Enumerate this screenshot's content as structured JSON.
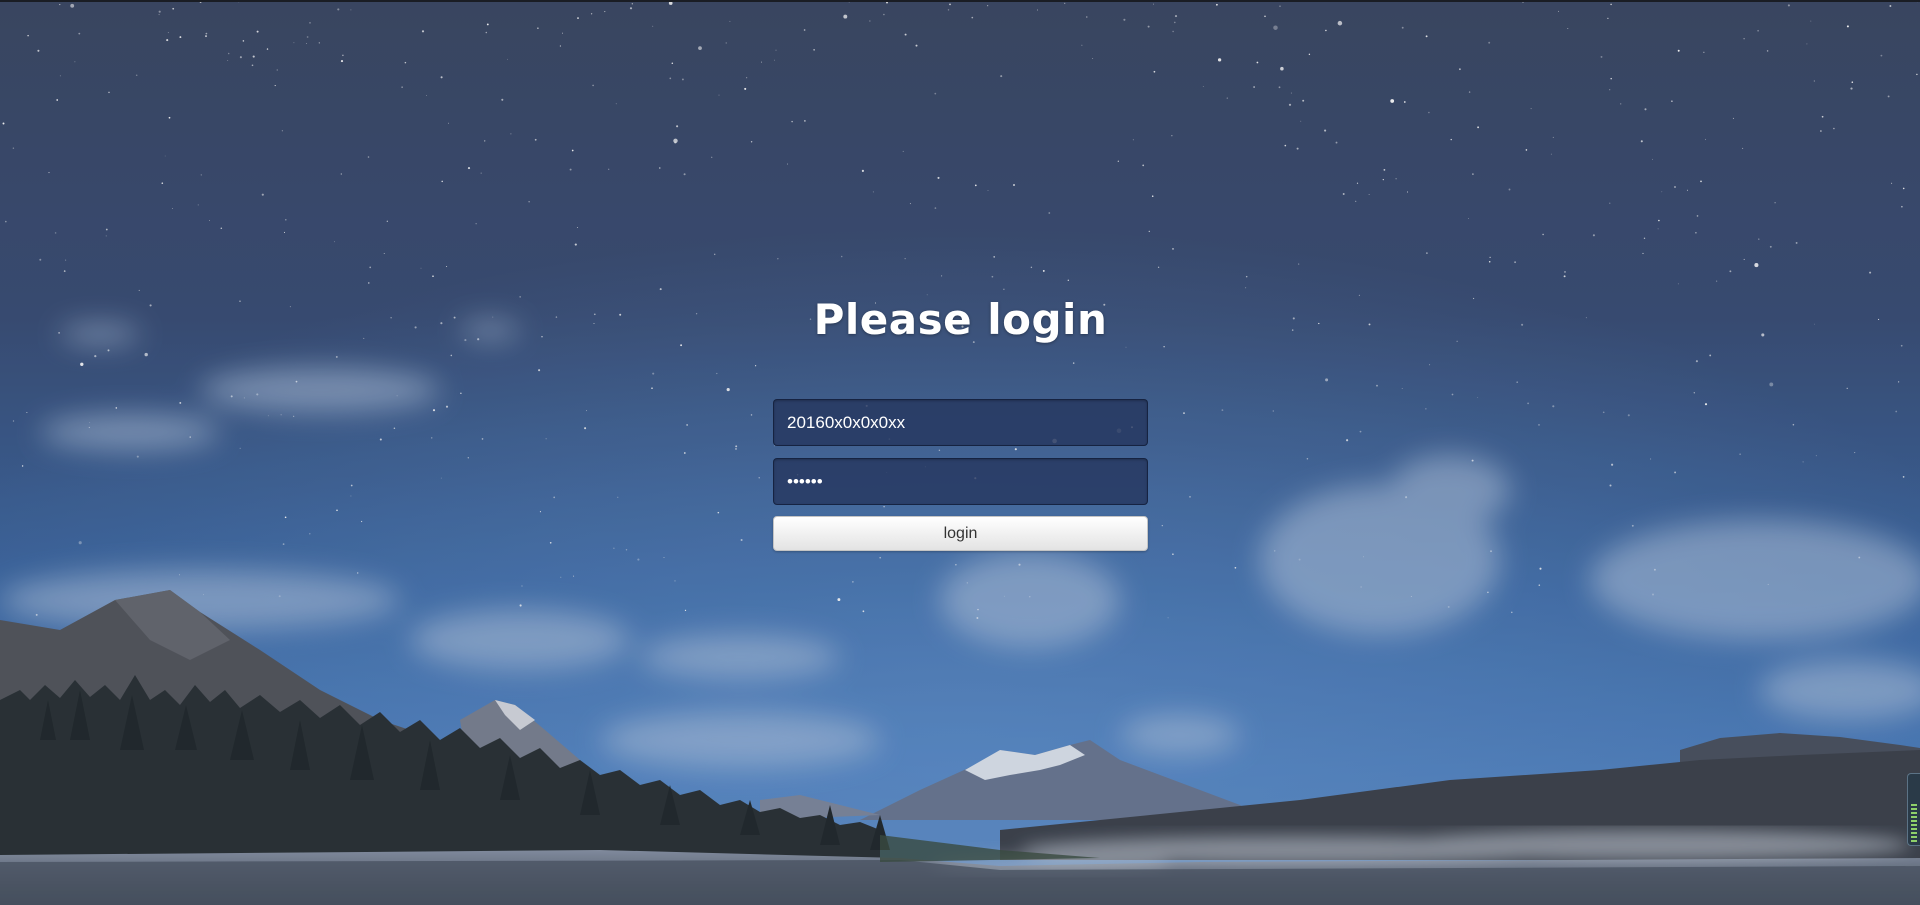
{
  "login": {
    "title": "Please login",
    "username_value": "20160x0x0x0xx",
    "password_value": "123456",
    "button_label": "login"
  }
}
